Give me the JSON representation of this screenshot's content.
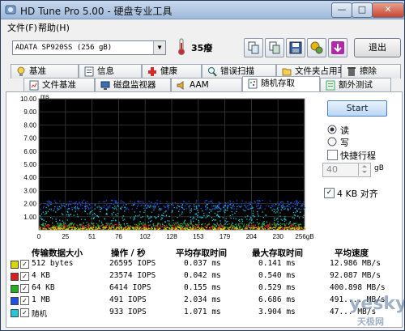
{
  "window": {
    "title": "HD Tune Pro 5.00 - 硬盘专业工具",
    "controls": {
      "minimize": "—",
      "maximize": "□",
      "close": "✕"
    }
  },
  "menu": [
    "文件(F)",
    "帮助(H)"
  ],
  "toolbar": {
    "drive": "ADATA   SP920SS          (256 gB)",
    "temperature": "35癈",
    "exit_label": "退出",
    "icons": [
      "copy-icon",
      "copy-info-icon",
      "save-icon",
      "options-icon",
      "download-icon"
    ]
  },
  "tabs_row1": [
    "基准",
    "信息",
    "健康",
    "错误扫描",
    "文件夹占用率",
    "擦除"
  ],
  "tabs_row2": [
    "文件基准",
    "磁盘监视器",
    "AAM",
    "随机存取",
    "额外测试"
  ],
  "active_tab": "随机存取",
  "chart_data": {
    "type": "scatter",
    "ylabel": "ms",
    "ylim": [
      0,
      10
    ],
    "yticks": [
      "10.00",
      "9.00",
      "8.00",
      "7.00",
      "6.00",
      "5.00",
      "4.00",
      "3.00",
      "2.00",
      "1.00"
    ],
    "xlim": [
      0,
      256
    ],
    "xticks": [
      "0",
      "25",
      "51",
      "76",
      "102",
      "128",
      "153",
      "179",
      "204",
      "230",
      "256gB"
    ],
    "grid": true,
    "series": [
      {
        "name": "512 bytes",
        "color": "#d8d800",
        "band": [
          0.05,
          0.25
        ]
      },
      {
        "name": "4 KB",
        "color": "#d82020",
        "band": [
          0.05,
          0.45
        ]
      },
      {
        "name": "64 KB",
        "color": "#20b020",
        "band": [
          0.1,
          0.55
        ]
      },
      {
        "name": "1 MB",
        "color": "#2050e0",
        "band": [
          1.6,
          2.3
        ]
      },
      {
        "name": "随机",
        "color": "#20c8d8",
        "band": [
          0.3,
          2.0
        ]
      }
    ]
  },
  "controls": {
    "start": "Start",
    "read": "读",
    "write": "写",
    "short_stroke": "快捷行程",
    "short_stroke_value": "40",
    "short_stroke_unit": "gB",
    "align_4kb": "4 KB 对齐"
  },
  "table": {
    "headers": [
      "传输数据大小",
      "操作 / 秒",
      "平均存取时间",
      "最大存取时间",
      "平均速度"
    ],
    "rows": [
      {
        "size": "512 bytes",
        "ops": "26595 IOPS",
        "avg": "0.037 ms",
        "max": "0.141 ms",
        "speed": "12.986 MB/s",
        "color": "#d8d800"
      },
      {
        "size": "4 KB",
        "ops": "23574 IOPS",
        "avg": "0.042 ms",
        "max": "0.540 ms",
        "speed": "92.087 MB/s",
        "color": "#d82020"
      },
      {
        "size": "64 KB",
        "ops": "6414 IOPS",
        "avg": "0.155 ms",
        "max": "0.529 ms",
        "speed": "400.898 MB/s",
        "color": "#20b020"
      },
      {
        "size": "1 MB",
        "ops": "491 IOPS",
        "avg": "2.034 ms",
        "max": "6.686 ms",
        "speed": "491.... MB/s",
        "color": "#2050e0"
      },
      {
        "size": "随机",
        "ops": "933 IOPS",
        "avg": "1.071 ms",
        "max": "3.904 ms",
        "speed": "47... MB/s",
        "color": "#20c8d8"
      }
    ]
  },
  "watermark": {
    "brand": "yesky",
    "sub": "天极网"
  }
}
